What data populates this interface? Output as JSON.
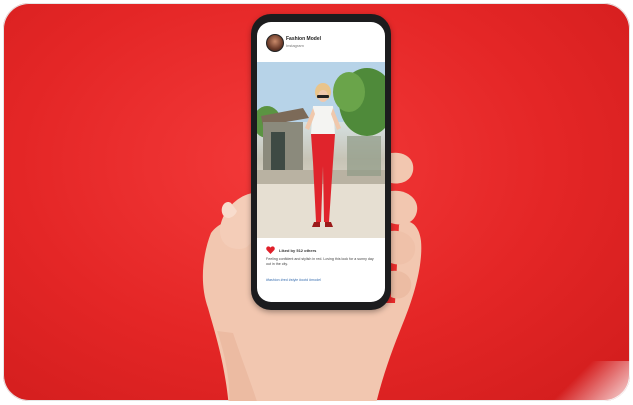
{
  "post": {
    "username": "Fashion Model",
    "location": "Instagram",
    "likes": "Liked by 512 others",
    "caption": "Feeling confident and stylish in red. Loving this look for a sunny day out in the city.",
    "hashtags": "#fashion #red #style #ootd #model"
  },
  "colors": {
    "background": "#e42626",
    "phone_body": "#1c1c1e",
    "heart": "#e0202a",
    "outfit": "#e0242c"
  },
  "icons": {
    "like": "heart-icon"
  }
}
